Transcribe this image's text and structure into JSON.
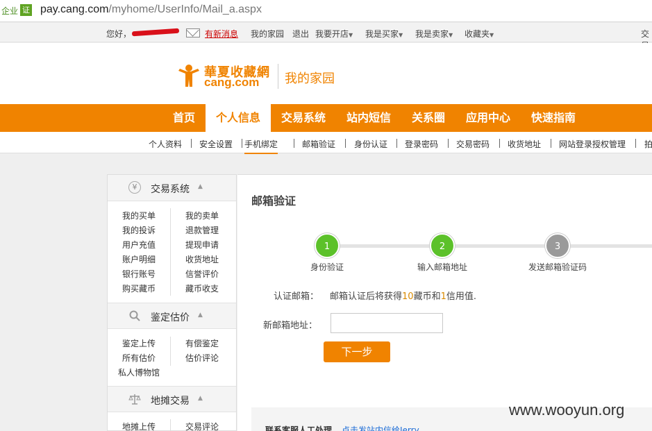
{
  "browser": {
    "badge_text": "企业",
    "badge_icon": "证",
    "url_host": "pay.cang.com",
    "url_path": "/myhome/UserInfo/Mail_a.aspx"
  },
  "topbar": {
    "greeting": "您好，",
    "new_message": "有新消息",
    "my_home": "我的家园",
    "logout": "退出",
    "open_shop": "我要开店",
    "buyer": "我是买家",
    "seller": "我是卖家",
    "favorites": "收藏夹",
    "right_cut": "交易"
  },
  "header": {
    "logo_cn": "華夏收藏網",
    "logo_en": "cang.com",
    "section": "我的家园"
  },
  "nav": [
    "首页",
    "个人信息",
    "交易系统",
    "站内短信",
    "关系圈",
    "应用中心",
    "快速指南"
  ],
  "subnav": [
    "个人资料",
    "安全设置",
    "手机绑定",
    "邮箱验证",
    "身份认证",
    "登录密码",
    "交易密码",
    "收货地址",
    "网站登录授权管理",
    "拍"
  ],
  "sidebar": {
    "trade": {
      "icon": "¥",
      "title": "交易系统",
      "left": [
        "我的买单",
        "我的投诉",
        "用户充值",
        "账户明细",
        "银行账号",
        "购买藏币"
      ],
      "right": [
        "我的卖单",
        "退款管理",
        "提现申请",
        "收货地址",
        "信誉评价",
        "藏币收支"
      ]
    },
    "appraise": {
      "title": "鉴定估价",
      "left": [
        "鉴定上传",
        "所有估价",
        "私人博物馆"
      ],
      "right": [
        "有偿鉴定",
        "估价评论"
      ]
    },
    "stall": {
      "title": "地摊交易",
      "left": [
        "地摊上传"
      ],
      "right": [
        "交易评论"
      ]
    }
  },
  "content": {
    "title": "邮箱验证",
    "steps": [
      {
        "num": "1",
        "label": "身份验证"
      },
      {
        "num": "2",
        "label": "输入邮箱地址"
      },
      {
        "num": "3",
        "label": "发送邮箱验证码"
      }
    ],
    "verify_label": "认证邮箱：",
    "verify_pre": "邮箱认证后将获得",
    "verify_coins": "10",
    "verify_mid": "藏币和",
    "verify_credit": "1",
    "verify_post": "信用值.",
    "email_label": "新邮箱地址：",
    "email_value": "",
    "next_button": "下一步",
    "contact_label": "联系客服人工处理",
    "contact_link": "点击发站内信给Jerry"
  },
  "watermark": "www.wooyun.org",
  "colors": {
    "brand": "#f08300",
    "step_done": "#5cc12a",
    "step_todo": "#9a9a9a"
  }
}
